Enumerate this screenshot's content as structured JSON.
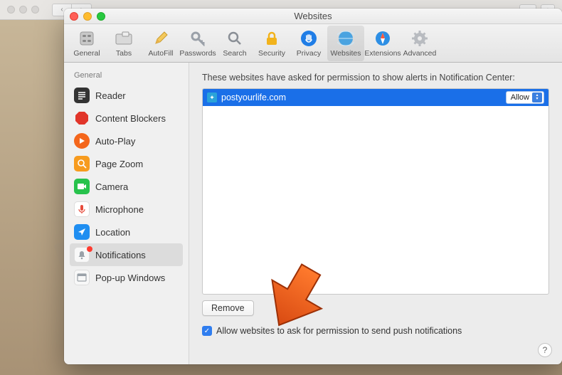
{
  "window_title": "Websites",
  "toolbar": [
    {
      "id": "general",
      "label": "General"
    },
    {
      "id": "tabs",
      "label": "Tabs"
    },
    {
      "id": "autofill",
      "label": "AutoFill"
    },
    {
      "id": "passwords",
      "label": "Passwords"
    },
    {
      "id": "search",
      "label": "Search"
    },
    {
      "id": "security",
      "label": "Security"
    },
    {
      "id": "privacy",
      "label": "Privacy"
    },
    {
      "id": "websites",
      "label": "Websites",
      "selected": true
    },
    {
      "id": "extensions",
      "label": "Extensions"
    },
    {
      "id": "advanced",
      "label": "Advanced"
    }
  ],
  "sidebar": {
    "header": "General",
    "items": [
      {
        "id": "reader",
        "label": "Reader",
        "color": "#333"
      },
      {
        "id": "blockers",
        "label": "Content Blockers",
        "color": "#e1352a"
      },
      {
        "id": "autoplay",
        "label": "Auto-Play",
        "color": "#f4661b"
      },
      {
        "id": "zoom",
        "label": "Page Zoom",
        "color": "#f79b1e"
      },
      {
        "id": "camera",
        "label": "Camera",
        "color": "#27c24c"
      },
      {
        "id": "microphone",
        "label": "Microphone",
        "color": "#e74c3c"
      },
      {
        "id": "location",
        "label": "Location",
        "color": "#1f8ef1"
      },
      {
        "id": "notifications",
        "label": "Notifications",
        "color": "#f5f5f5",
        "selected": true,
        "badge": true
      },
      {
        "id": "popups",
        "label": "Pop-up Windows",
        "color": "#f5f5f5"
      }
    ]
  },
  "main": {
    "description": "These websites have asked for permission to show alerts in Notification Center:",
    "rows": [
      {
        "site": "postyourlife.com",
        "permission": "Allow",
        "selected": true
      }
    ],
    "remove_label": "Remove",
    "checkbox_label": "Allow websites to ask for permission to send push notifications",
    "checkbox_checked": true,
    "help_label": "?"
  }
}
